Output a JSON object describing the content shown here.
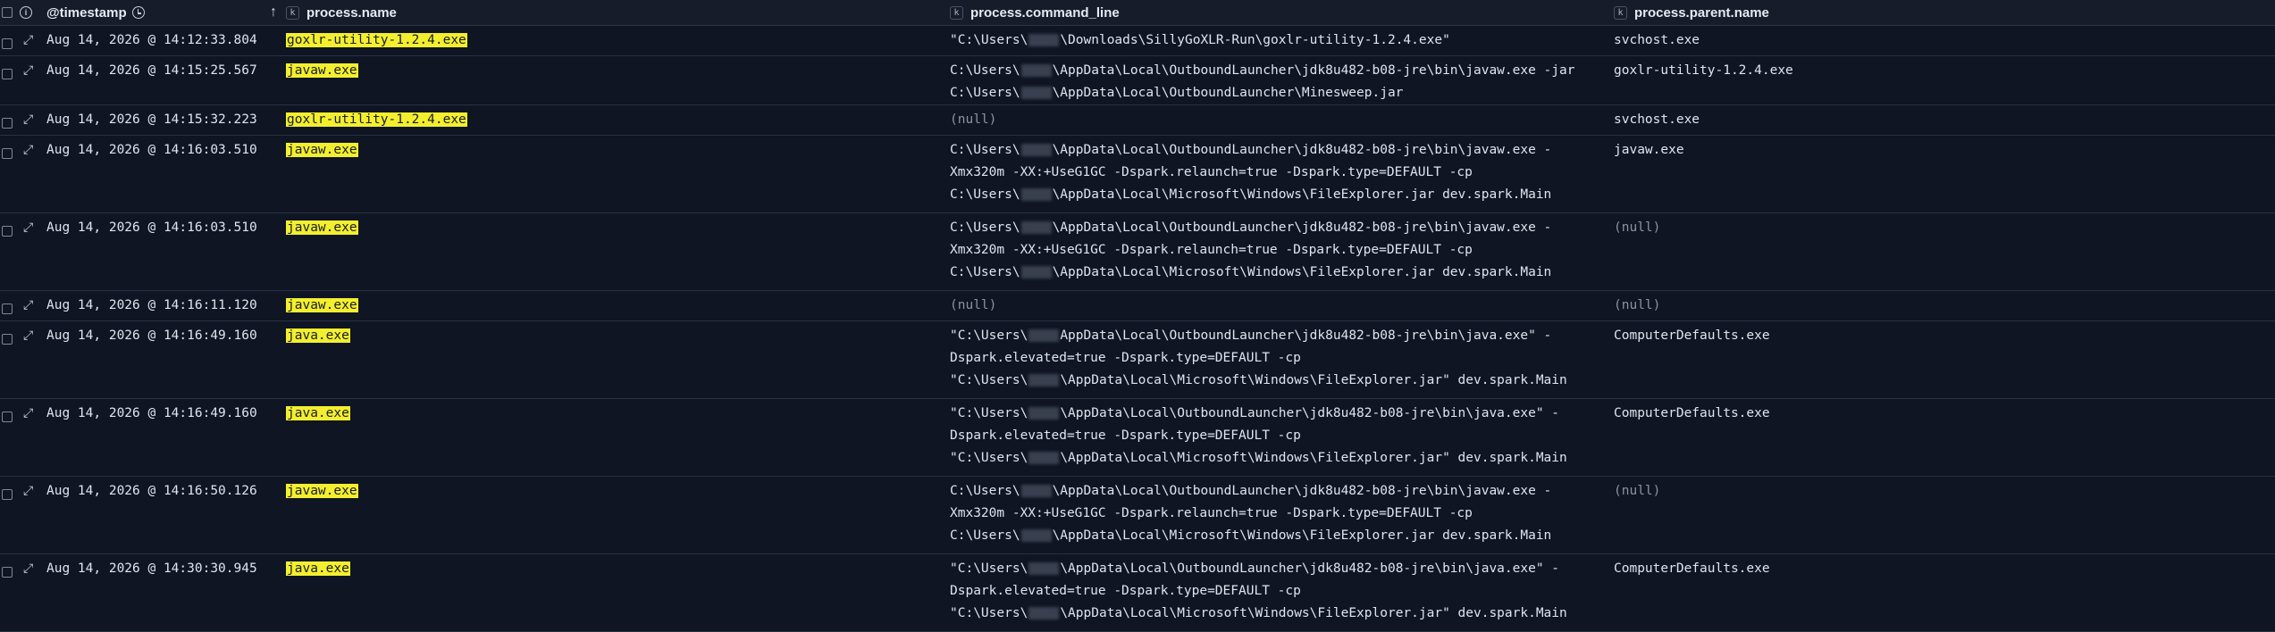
{
  "columns": {
    "timestamp": "@timestamp",
    "name": "process.name",
    "cmd": "process.command_line",
    "parent": "process.parent.name",
    "type_badge": "k",
    "sort_icon": "arrow-up-icon"
  },
  "rows": [
    {
      "timestamp": "Aug 14, 2026 @ 14:12:33.804",
      "name": "goxlr-utility-1.2.4.exe",
      "cmd": [
        "\"C:\\Users\\",
        "\\Downloads\\SillyGoXLR-Run\\goxlr-utility-1.2.4.exe\""
      ],
      "parent": "svchost.exe"
    },
    {
      "timestamp": "Aug 14, 2026 @ 14:15:25.567",
      "name": "javaw.exe",
      "cmd": [
        "C:\\Users\\",
        "\\AppData\\Local\\OutboundLauncher\\jdk8u482-b08-jre\\bin\\javaw.exe -jar",
        "C:\\Users\\",
        "\\AppData\\Local\\OutboundLauncher\\Minesweep.jar"
      ],
      "parent": "goxlr-utility-1.2.4.exe"
    },
    {
      "timestamp": "Aug 14, 2026 @ 14:15:32.223",
      "name": "goxlr-utility-1.2.4.exe",
      "cmd_null": "(null)",
      "parent": "svchost.exe"
    },
    {
      "timestamp": "Aug 14, 2026 @ 14:16:03.510",
      "name": "javaw.exe",
      "cmd": [
        "C:\\Users\\",
        "\\AppData\\Local\\OutboundLauncher\\jdk8u482-b08-jre\\bin\\javaw.exe -",
        "Xmx320m -XX:+UseG1GC -Dspark.relaunch=true -Dspark.type=DEFAULT -cp",
        "C:\\Users\\",
        "\\AppData\\Local\\Microsoft\\Windows\\FileExplorer.jar dev.spark.Main"
      ],
      "parent": "javaw.exe"
    },
    {
      "timestamp": "Aug 14, 2026 @ 14:16:03.510",
      "name": "javaw.exe",
      "cmd": [
        "C:\\Users\\",
        "\\AppData\\Local\\OutboundLauncher\\jdk8u482-b08-jre\\bin\\javaw.exe -",
        "Xmx320m -XX:+UseG1GC -Dspark.relaunch=true -Dspark.type=DEFAULT -cp",
        "C:\\Users\\",
        "\\AppData\\Local\\Microsoft\\Windows\\FileExplorer.jar dev.spark.Main"
      ],
      "parent_null": "(null)"
    },
    {
      "timestamp": "Aug 14, 2026 @ 14:16:11.120",
      "name": "javaw.exe",
      "cmd_null": "(null)",
      "parent_null": "(null)"
    },
    {
      "timestamp": "Aug 14, 2026 @ 14:16:49.160",
      "name": "java.exe",
      "cmd": [
        "\"C:\\Users\\",
        "AppData\\Local\\OutboundLauncher\\jdk8u482-b08-jre\\bin\\java.exe\" -",
        "Dspark.elevated=true -Dspark.type=DEFAULT -cp",
        "\"C:\\Users\\",
        "\\AppData\\Local\\Microsoft\\Windows\\FileExplorer.jar\" dev.spark.Main"
      ],
      "parent": "ComputerDefaults.exe"
    },
    {
      "timestamp": "Aug 14, 2026 @ 14:16:49.160",
      "name": "java.exe",
      "cmd": [
        "\"C:\\Users\\",
        "\\AppData\\Local\\OutboundLauncher\\jdk8u482-b08-jre\\bin\\java.exe\" -",
        "Dspark.elevated=true -Dspark.type=DEFAULT -cp",
        "\"C:\\Users\\",
        "\\AppData\\Local\\Microsoft\\Windows\\FileExplorer.jar\" dev.spark.Main"
      ],
      "parent": "ComputerDefaults.exe"
    },
    {
      "timestamp": "Aug 14, 2026 @ 14:16:50.126",
      "name": "javaw.exe",
      "cmd": [
        "C:\\Users\\",
        "\\AppData\\Local\\OutboundLauncher\\jdk8u482-b08-jre\\bin\\javaw.exe -",
        "Xmx320m -XX:+UseG1GC -Dspark.relaunch=true -Dspark.type=DEFAULT -cp",
        "C:\\Users\\",
        "\\AppData\\Local\\Microsoft\\Windows\\FileExplorer.jar dev.spark.Main"
      ],
      "parent_null": "(null)"
    },
    {
      "timestamp": "Aug 14, 2026 @ 14:30:30.945",
      "name": "java.exe",
      "cmd": [
        "\"C:\\Users\\",
        "\\AppData\\Local\\OutboundLauncher\\jdk8u482-b08-jre\\bin\\java.exe\" -",
        "Dspark.elevated=true -Dspark.type=DEFAULT -cp",
        "\"C:\\Users\\",
        "\\AppData\\Local\\Microsoft\\Windows\\FileExplorer.jar\" dev.spark.Main"
      ],
      "parent": "ComputerDefaults.exe"
    }
  ],
  "colors": {
    "background": "#0f1522",
    "highlight": "#f3ef2f",
    "null_text": "#8c93a3"
  }
}
